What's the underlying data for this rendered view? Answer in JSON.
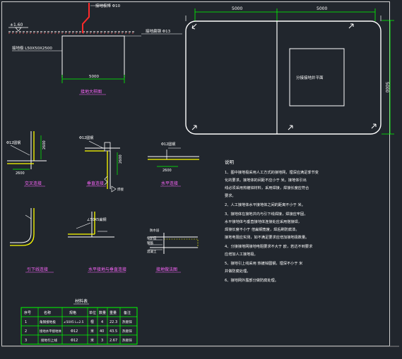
{
  "top_left": {
    "elevation_label": "±1.60",
    "earth_rod_note": "接地极棒 Φ10",
    "strip_note": "接地扁钢 Φ13",
    "angle_steel_note": "接地极 L50X50X2500",
    "width_dim": "5000",
    "caption": "接地大样图"
  },
  "top_right": {
    "dim_left": "5000",
    "dim_right": "5000",
    "dim_vertical": "5000",
    "box_label": "分接接地井平面"
  },
  "details": {
    "d1": {
      "dim_a": "Φ12圆钢",
      "dim_b": "2600",
      "dim_c": "2600",
      "caption": "交叉连接"
    },
    "d2": {
      "dim_a": "Φ12圆钢",
      "dim_b": "2600",
      "caption": "垂直连接"
    },
    "d3": {
      "dim_a": "Φ12圆钢",
      "dim_b": "2600",
      "caption": "水平连接"
    },
    "d4": {
      "caption": "引下线连接"
    },
    "d5": {
      "dim_a": "∠50X5扁钢",
      "caption": "水平接地与垂直连接"
    },
    "d6": {
      "labels": [
        "防水层",
        "保护层",
        "钢筋",
        "混凝土"
      ],
      "caption": "接地做法图"
    }
  },
  "notes": {
    "title": "说明",
    "lines": [
      "1、图中接地极采用人工方式的接地网，埋深应满足季节变",
      "   化的要求。接地体的间距不应小于    米。接地体引出",
      "   线必须采用热镀锌材料，采用焊接，焊接长度应符合",
      "   要求。",
      "2、人工接地体水平接地体之间的距离不小于    米。",
      "3、接地体在接地井内与引下线焊接，焊接应牢固，",
      "   水平接地体与垂直接地体连接处应采用搭接焊，",
      "   焊接长度不小于    倍扁钢宽度，焊后刷防腐漆。",
      "   接地电阻应实测，如不满足要求应增加接地极数量。",
      "4、分接接地网接地电阻要求不大于   欧，若达不到要求",
      "   应增加人工接地极。",
      "5、接地引上线采用    热镀锌圆钢，埋深不小于      米",
      "   并做防腐处理。",
      "6、接地网外露部分做防腐处理。"
    ]
  },
  "table": {
    "title": "材料表",
    "headers": [
      "序号",
      "名称",
      "规格",
      "单位",
      "数量",
      "重量",
      "备注"
    ],
    "rows": [
      [
        "1",
        "角钢接地极",
        "∠50X5 L=2.5",
        "根",
        "4",
        "22.3",
        "热镀锌"
      ],
      [
        "2",
        "接地水平接地体",
        "Φ12",
        "米",
        "40",
        "43.5",
        "热镀锌"
      ],
      [
        "3",
        "接地引上线",
        "Φ12",
        "米",
        "3",
        "2.67",
        "热镀锌"
      ]
    ]
  },
  "colors": {
    "background": "#21262d",
    "line": "#ffffff",
    "dim": "#00ff00",
    "accent": "#ff2a2a",
    "yellow": "#ffff00",
    "magenta": "#ff00ff"
  }
}
